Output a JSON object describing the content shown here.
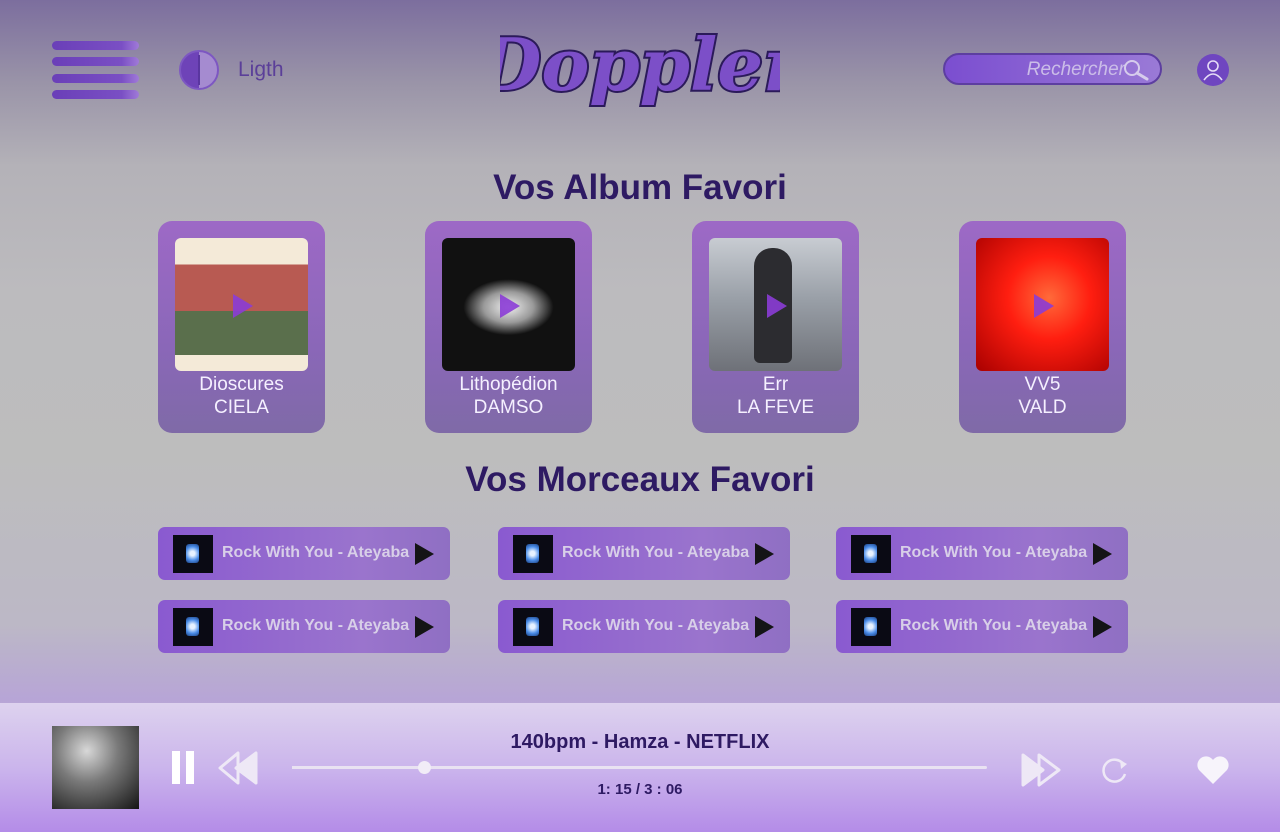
{
  "header": {
    "theme_label": "Ligth",
    "logo_text": "Doppler",
    "search_placeholder": "Rechercher"
  },
  "albums_section": {
    "title": "Vos Album Favori",
    "items": [
      {
        "title": "Dioscures",
        "artist": "CIELA",
        "cover_colors": [
          "#f4ead8",
          "#b85a52"
        ]
      },
      {
        "title": "Lithopédion",
        "artist": "DAMSO",
        "cover_colors": [
          "#111111",
          "#d8d8d8"
        ]
      },
      {
        "title": "Err",
        "artist": "LA FEVE",
        "cover_colors": [
          "#9aa0a8",
          "#3a3a3e"
        ]
      },
      {
        "title": "VV5",
        "artist": "VALD",
        "cover_colors": [
          "#ff2a1a",
          "#8a0000"
        ]
      }
    ]
  },
  "tracks_section": {
    "title": "Vos Morceaux Favori",
    "items": [
      {
        "label": "Rock With You - Ateyaba"
      },
      {
        "label": "Rock With You - Ateyaba"
      },
      {
        "label": "Rock With You - Ateyaba"
      },
      {
        "label": "Rock With You - Ateyaba"
      },
      {
        "label": "Rock With You - Ateyaba"
      },
      {
        "label": "Rock With You - Ateyaba"
      }
    ]
  },
  "player": {
    "now_playing": "140bpm - Hamza - NETFLIX",
    "time": "1: 15 / 3 : 06",
    "progress": 0.19
  },
  "colors": {
    "accent": "#7a4fc4",
    "title_text": "#2e1a63"
  }
}
